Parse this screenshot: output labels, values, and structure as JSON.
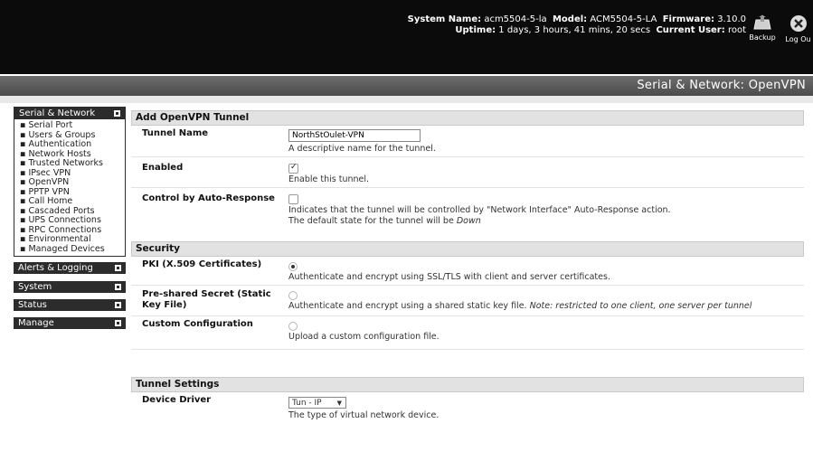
{
  "header": {
    "system_name_label": "System Name:",
    "system_name": "acm5504-5-la",
    "model_label": "Model:",
    "model": "ACM5504-5-LA",
    "firmware_label": "Firmware:",
    "firmware": "3.10.0",
    "uptime_label": "Uptime:",
    "uptime": "1 days, 3 hours, 41 mins, 20 secs",
    "current_user_label": "Current User:",
    "current_user": "root",
    "backup_label": "Backup",
    "logout_label": "Log Ou"
  },
  "page": {
    "title": "Serial & Network: OpenVPN"
  },
  "sidebar": {
    "serial_network": {
      "title": "Serial & Network",
      "items": [
        "Serial Port",
        "Users & Groups",
        "Authentication",
        "Network Hosts",
        "Trusted Networks",
        "IPsec VPN",
        "OpenVPN",
        "PPTP VPN",
        "Call Home",
        "Cascaded Ports",
        "UPS Connections",
        "RPC Connections",
        "Environmental",
        "Managed Devices"
      ]
    },
    "alerts": "Alerts & Logging",
    "system": "System",
    "status": "Status",
    "manage": "Manage"
  },
  "add_tunnel": {
    "title": "Add OpenVPN Tunnel",
    "tunnel_name_label": "Tunnel Name",
    "tunnel_name_value": "NorthStOulet-VPN",
    "tunnel_name_help": "A descriptive name for the tunnel.",
    "enabled_label": "Enabled",
    "enabled_help": "Enable this tunnel.",
    "control_label": "Control by Auto-Response",
    "control_help1": "Indicates that the tunnel will be controlled by \"Network Interface\" Auto-Response action.",
    "control_help2_prefix": "The default state for the tunnel will be ",
    "control_help2_state": "Down"
  },
  "security": {
    "title": "Security",
    "pki_label": "PKI (X.509 Certificates)",
    "pki_help": "Authenticate and encrypt using SSL/TLS with client and server certificates.",
    "psk_label": "Pre-shared Secret (Static Key File)",
    "psk_help": "Authenticate and encrypt using a shared static key file. ",
    "psk_note": "Note: restricted to one client, one server per tunnel",
    "custom_label": "Custom Configuration",
    "custom_help": "Upload a custom configuration file."
  },
  "tunnel_settings": {
    "title": "Tunnel Settings",
    "device_driver_label": "Device Driver",
    "device_driver_value": "Tun - IP",
    "device_driver_help": "The type of virtual network device."
  },
  "state": {
    "enabled_checked": true,
    "control_checked": false,
    "auth_selected": "pki"
  }
}
